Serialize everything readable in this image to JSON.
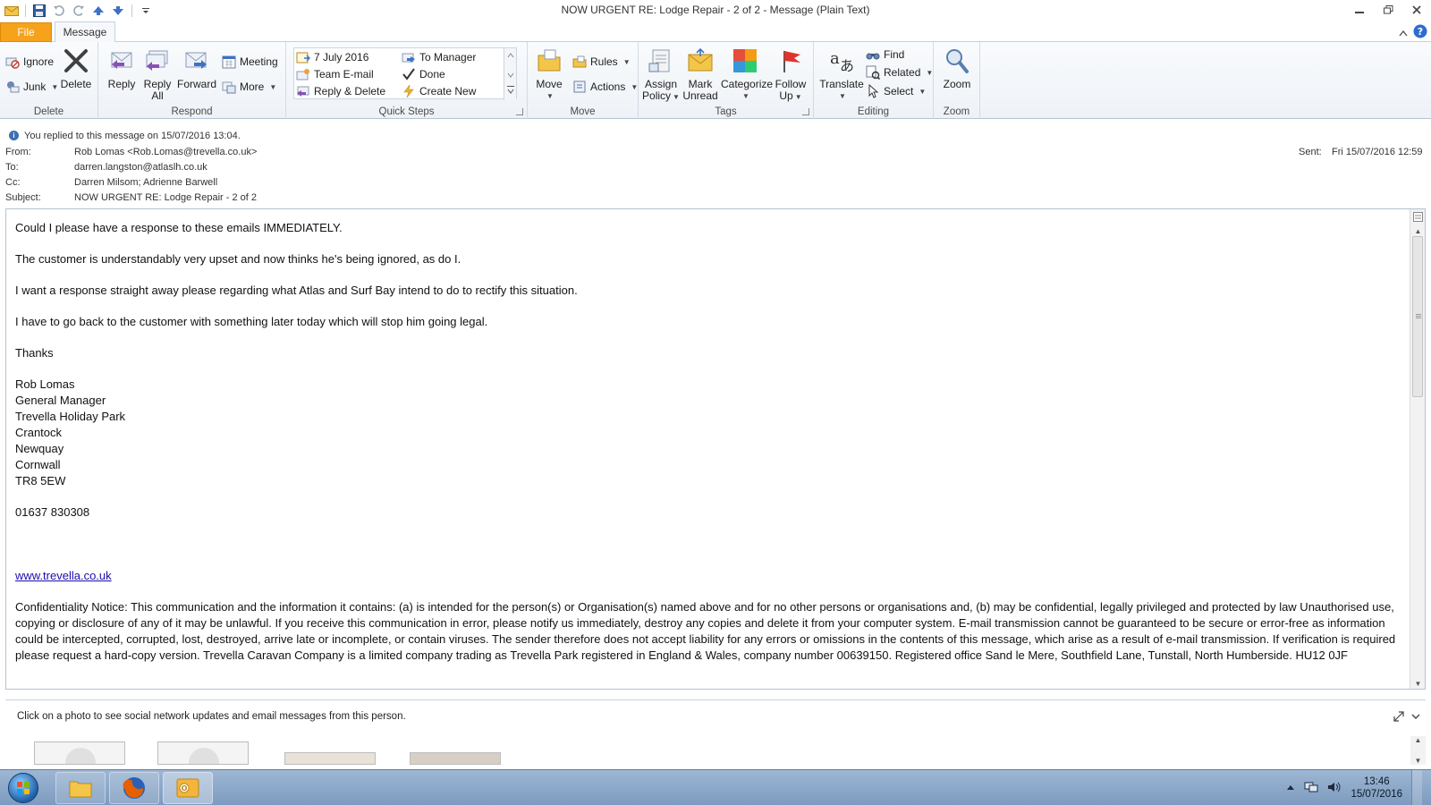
{
  "window": {
    "title": "NOW URGENT   RE: Lodge Repair - 2 of 2  -  Message (Plain Text)",
    "controls": [
      "minimize",
      "restore",
      "close"
    ]
  },
  "tabs": {
    "file": "File",
    "message": "Message"
  },
  "ribbon": {
    "delete": {
      "label": "Delete",
      "ignore": "Ignore",
      "junk": "Junk",
      "delete": "Delete"
    },
    "respond": {
      "label": "Respond",
      "reply": "Reply",
      "reply_all_1": "Reply",
      "reply_all_2": "All",
      "forward": "Forward",
      "meeting": "Meeting",
      "more": "More"
    },
    "quick_steps": {
      "label": "Quick Steps",
      "items": [
        "7 July 2016",
        "Team E-mail",
        "Reply & Delete",
        "To Manager",
        "Done",
        "Create New"
      ]
    },
    "move": {
      "label": "Move",
      "move": "Move",
      "rules": "Rules",
      "actions": "Actions"
    },
    "tags": {
      "label": "Tags",
      "assign_1": "Assign",
      "assign_2": "Policy",
      "mark_1": "Mark",
      "mark_2": "Unread",
      "categorize": "Categorize",
      "follow_1": "Follow",
      "follow_2": "Up"
    },
    "editing": {
      "label": "Editing",
      "translate": "Translate",
      "find": "Find",
      "related": "Related",
      "select": "Select"
    },
    "zoom": {
      "label": "Zoom",
      "zoom": "Zoom"
    }
  },
  "message": {
    "info": "You replied to this message on 15/07/2016 13:04.",
    "from_label": "From:",
    "from": "Rob Lomas <Rob.Lomas@trevella.co.uk>",
    "to_label": "To:",
    "to": "darren.langston@atlaslh.co.uk",
    "cc_label": "Cc:",
    "cc": "Darren Milsom; Adrienne Barwell",
    "subject_label": "Subject:",
    "subject": "NOW URGENT   RE: Lodge Repair - 2 of 2",
    "sent_label": "Sent:",
    "sent": "Fri 15/07/2016 12:59"
  },
  "body": {
    "p1": "Could I please have a response to these emails IMMEDIATELY.",
    "p2": "The customer is understandably very upset and now thinks he's being ignored, as do I.",
    "p3": "I want a response straight away please regarding what Atlas and Surf Bay intend to do to rectify this situation.",
    "p4": "I have to go back to the customer with something later today which will stop him going legal.",
    "thanks": "Thanks",
    "signature": [
      "Rob Lomas",
      "General Manager",
      "Trevella Holiday Park",
      "Crantock",
      "Newquay",
      "Cornwall",
      "TR8 5EW"
    ],
    "phone": "01637 830308",
    "website": "www.trevella.co.uk",
    "notice": "Confidentiality Notice: This communication and the information it contains: (a) is intended for the person(s) or Organisation(s) named above and for no other persons or organisations and, (b) may be confidential, legally privileged and protected by law Unauthorised use, copying or disclosure of any of it may be unlawful. If you receive this communication in error, please notify us immediately, destroy any copies and delete it from your computer system. E-mail transmission cannot be guaranteed to be secure or error-free as information could be intercepted, corrupted, lost, destroyed, arrive late or incomplete, or contain viruses. The sender therefore does not accept liability for any errors or omissions in the contents of this message, which arise as a result of e-mail transmission. If verification is required please request a hard-copy version. Trevella Caravan Company is a limited company trading as Trevella Park registered in England & Wales, company number 00639150. Registered office Sand le Mere, Southfield Lane, Tunstall, North Humberside. HU12 0JF"
  },
  "people_pane": {
    "header": "Click on a photo to see social network updates and email messages from this person."
  },
  "taskbar": {
    "time": "13:46",
    "date": "15/07/2016"
  },
  "colors": {
    "file_tab": "#f6a21b",
    "link": "#1a0dab",
    "ribbon_border": "#b6c3d3"
  }
}
